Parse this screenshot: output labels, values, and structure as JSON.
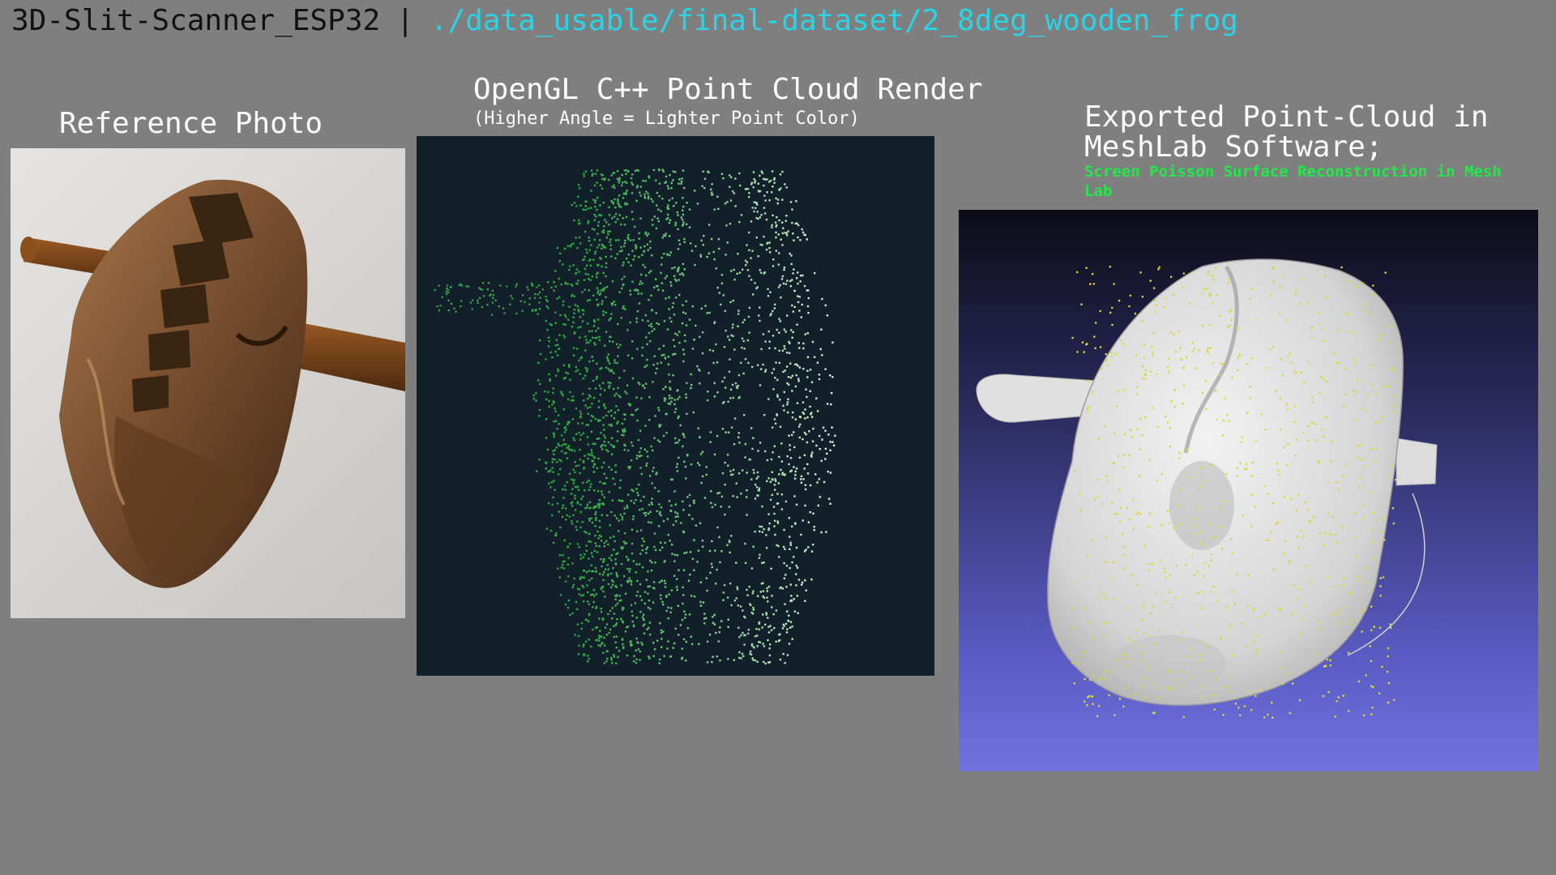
{
  "header": {
    "project": "3D-Slit-Scanner_ESP32",
    "separator": "|",
    "path": "./data_usable/final-dataset/2_8deg_wooden_frog"
  },
  "panels": {
    "photo": {
      "title": "Reference Photo"
    },
    "render": {
      "title": "OpenGL C++ Point Cloud Render",
      "subtitle": "(Higher Angle = Lighter Point Color)"
    },
    "meshlab": {
      "title_line1": "Exported Point-Cloud in",
      "title_line2": "MeshLab Software;",
      "note": "Screen Poisson Surface Reconstruction in Mesh Lab"
    }
  },
  "colors": {
    "background": "#7f7f7f",
    "path_accent": "#2ad3e6",
    "note_green": "#22e84a",
    "gl_background": "#12202a",
    "point_dark": "#2ea843",
    "point_light": "#dff5df",
    "mesh_gradient_top": "#0c0c18",
    "mesh_gradient_bottom": "#7172e0"
  }
}
